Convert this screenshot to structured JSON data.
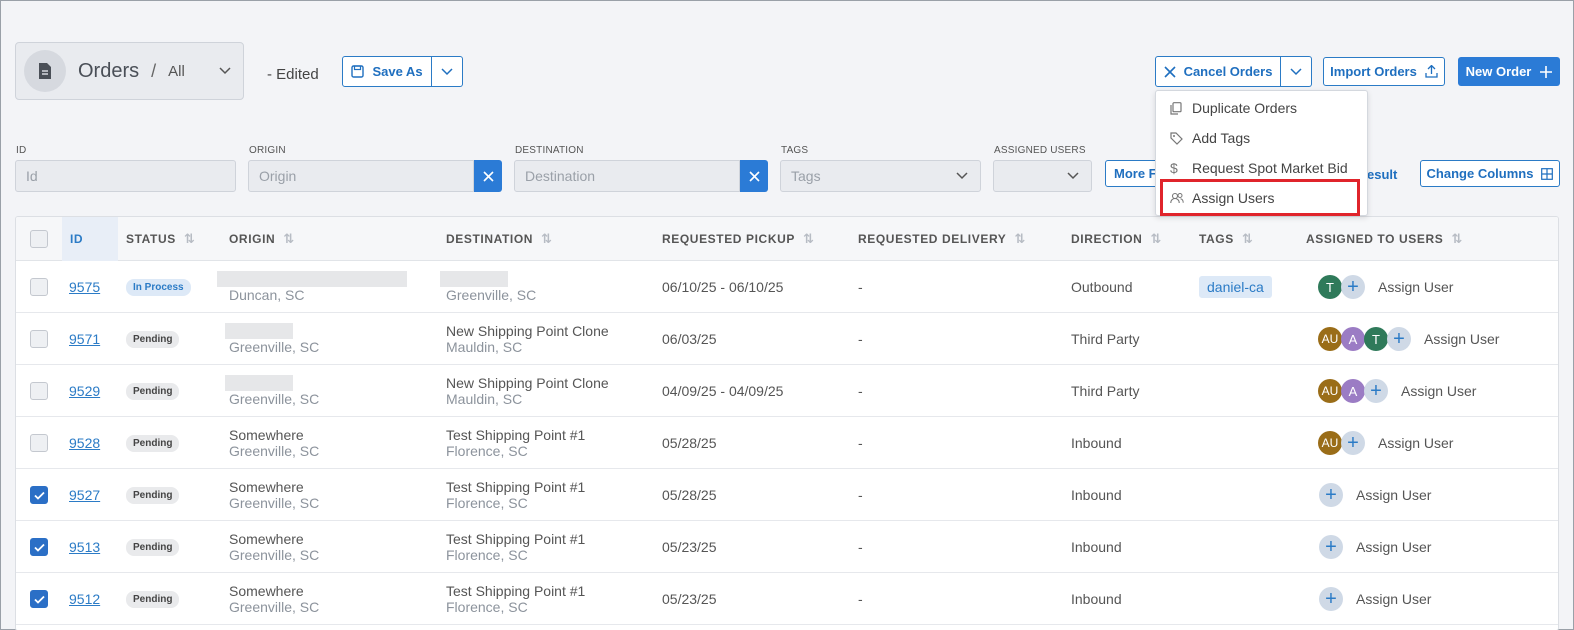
{
  "header": {
    "title": "Orders",
    "separator": "/",
    "view": "All",
    "edited": "- Edited",
    "save_as": "Save As",
    "cancel_orders": "Cancel Orders",
    "import_orders": "Import Orders",
    "new_order": "New Order"
  },
  "filters": {
    "id_label": "ID",
    "id_placeholder": "Id",
    "origin_label": "ORIGIN",
    "origin_placeholder": "Origin",
    "destination_label": "DESTINATION",
    "destination_placeholder": "Destination",
    "tags_label": "TAGS",
    "tags_placeholder": "Tags",
    "assigned_label": "ASSIGNED USERS",
    "more_filters": "More F",
    "result_fragment": "esult",
    "change_columns": "Change Columns"
  },
  "menu": {
    "items": [
      {
        "label": "Duplicate Orders",
        "icon": "copy-icon"
      },
      {
        "label": "Add Tags",
        "icon": "tag-icon"
      },
      {
        "label": "Request Spot Market Bid",
        "icon": "dollar-icon"
      },
      {
        "label": "Assign Users",
        "icon": "users-icon"
      }
    ]
  },
  "columns": [
    "ID",
    "STATUS",
    "ORIGIN",
    "DESTINATION",
    "REQUESTED PICKUP",
    "REQUESTED DELIVERY",
    "DIRECTION",
    "TAGS",
    "ASSIGNED TO USERS"
  ],
  "rows": [
    {
      "id": "9575",
      "status": "In Process",
      "origin_name": "",
      "origin_city": "Duncan, SC",
      "dest_name": "",
      "dest_city": "Greenville, SC",
      "pickup": "06/10/25 - 06/10/25",
      "delivery": "-",
      "direction": "Outbound",
      "tag": "daniel-ca",
      "avatars": [
        "T"
      ],
      "assign": "Assign User",
      "checked": false
    },
    {
      "id": "9571",
      "status": "Pending",
      "origin_name": "",
      "origin_city": "Greenville, SC",
      "dest_name": "New Shipping Point Clone",
      "dest_city": "Mauldin, SC",
      "pickup": "06/03/25",
      "delivery": "-",
      "direction": "Third Party",
      "tag": "",
      "avatars": [
        "AU",
        "A",
        "T"
      ],
      "assign": "Assign User",
      "checked": false
    },
    {
      "id": "9529",
      "status": "Pending",
      "origin_name": "",
      "origin_city": "Greenville, SC",
      "dest_name": "New Shipping Point Clone",
      "dest_city": "Mauldin, SC",
      "pickup": "04/09/25 - 04/09/25",
      "delivery": "-",
      "direction": "Third Party",
      "tag": "",
      "avatars": [
        "AU",
        "A"
      ],
      "assign": "Assign User",
      "checked": false
    },
    {
      "id": "9528",
      "status": "Pending",
      "origin_name": "Somewhere",
      "origin_city": "Greenville, SC",
      "dest_name": "Test Shipping Point #1",
      "dest_city": "Florence, SC",
      "pickup": "05/28/25",
      "delivery": "-",
      "direction": "Inbound",
      "tag": "",
      "avatars": [
        "AU"
      ],
      "assign": "Assign User",
      "checked": false
    },
    {
      "id": "9527",
      "status": "Pending",
      "origin_name": "Somewhere",
      "origin_city": "Greenville, SC",
      "dest_name": "Test Shipping Point #1",
      "dest_city": "Florence, SC",
      "pickup": "05/28/25",
      "delivery": "-",
      "direction": "Inbound",
      "tag": "",
      "avatars": [],
      "assign": "Assign User",
      "checked": true
    },
    {
      "id": "9513",
      "status": "Pending",
      "origin_name": "Somewhere",
      "origin_city": "Greenville, SC",
      "dest_name": "Test Shipping Point #1",
      "dest_city": "Florence, SC",
      "pickup": "05/23/25",
      "delivery": "-",
      "direction": "Inbound",
      "tag": "",
      "avatars": [],
      "assign": "Assign User",
      "checked": true
    },
    {
      "id": "9512",
      "status": "Pending",
      "origin_name": "Somewhere",
      "origin_city": "Greenville, SC",
      "dest_name": "Test Shipping Point #1",
      "dest_city": "Florence, SC",
      "pickup": "05/23/25",
      "delivery": "-",
      "direction": "Inbound",
      "tag": "",
      "avatars": [],
      "assign": "Assign User",
      "checked": true
    }
  ],
  "colors": {
    "accent": "#2b7bd6",
    "link": "#2b7bc6",
    "highlight": "#e0242b",
    "checked": "#2b6fc6"
  }
}
